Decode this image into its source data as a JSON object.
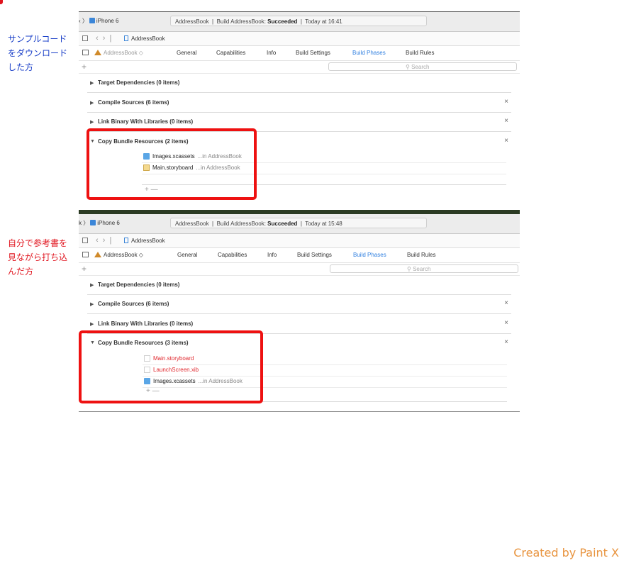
{
  "side_labels": {
    "top": {
      "lines": [
        "サンプルコード",
        "をダウンロード",
        "した方"
      ],
      "color": "#1a3fc8"
    },
    "bottom": {
      "lines": [
        "自分で参考書を",
        "見ながら打ち込",
        "んだ方"
      ],
      "color": "#e0141e"
    }
  },
  "shared": {
    "device": "iPhone 6",
    "file": "AddressBook",
    "target": "AddressBook ◇",
    "tabs": [
      "General",
      "Capabilities",
      "Info",
      "Build Settings",
      "Build Phases",
      "Build Rules"
    ],
    "active_tab": "Build Phases",
    "search_placeholder": "Search",
    "plus": "+",
    "remove": "×",
    "add_minus": "+  —"
  },
  "top_panel": {
    "device_prefix": "‹ 〉",
    "activity": {
      "project": "AddressBook",
      "build": "Build AddressBook:",
      "status": "Succeeded",
      "time": "Today at 16:41"
    },
    "phases": [
      "Target Dependencies (0 items)",
      "Compile Sources (6 items)",
      "Link Binary With Libraries (0 items)",
      "Copy Bundle Resources (2 items)"
    ],
    "files": [
      {
        "name": "Images.xcassets",
        "location": "...in AddressBook",
        "icon": "folder-icon"
      },
      {
        "name": "Main.storyboard",
        "location": "...in AddressBook",
        "icon": "storyboard-file-icon"
      }
    ]
  },
  "bottom_panel": {
    "device_prefix": "k 〉",
    "activity": {
      "project": "AddressBook",
      "build": "Build AddressBook:",
      "status": "Succeeded",
      "time": "Today at 15:48"
    },
    "phases": [
      "Target Dependencies (0 items)",
      "Compile Sources (6 items)",
      "Link Binary With Libraries (0 items)",
      "Copy Bundle Resources (3 items)"
    ],
    "files": [
      {
        "name": "Main.storyboard",
        "location": "",
        "icon": "missing-file-icon"
      },
      {
        "name": "LaunchScreen.xib",
        "location": "",
        "icon": "missing-file-icon"
      },
      {
        "name": "Images.xcassets",
        "location": "...in AddressBook",
        "icon": "folder-icon"
      }
    ]
  },
  "credit": "Created by Paint X",
  "colors": {
    "highlight": "#ee1111",
    "active_tab": "#2f7fe0",
    "missing_file": "#e0282e",
    "credit": "#e8943f"
  }
}
